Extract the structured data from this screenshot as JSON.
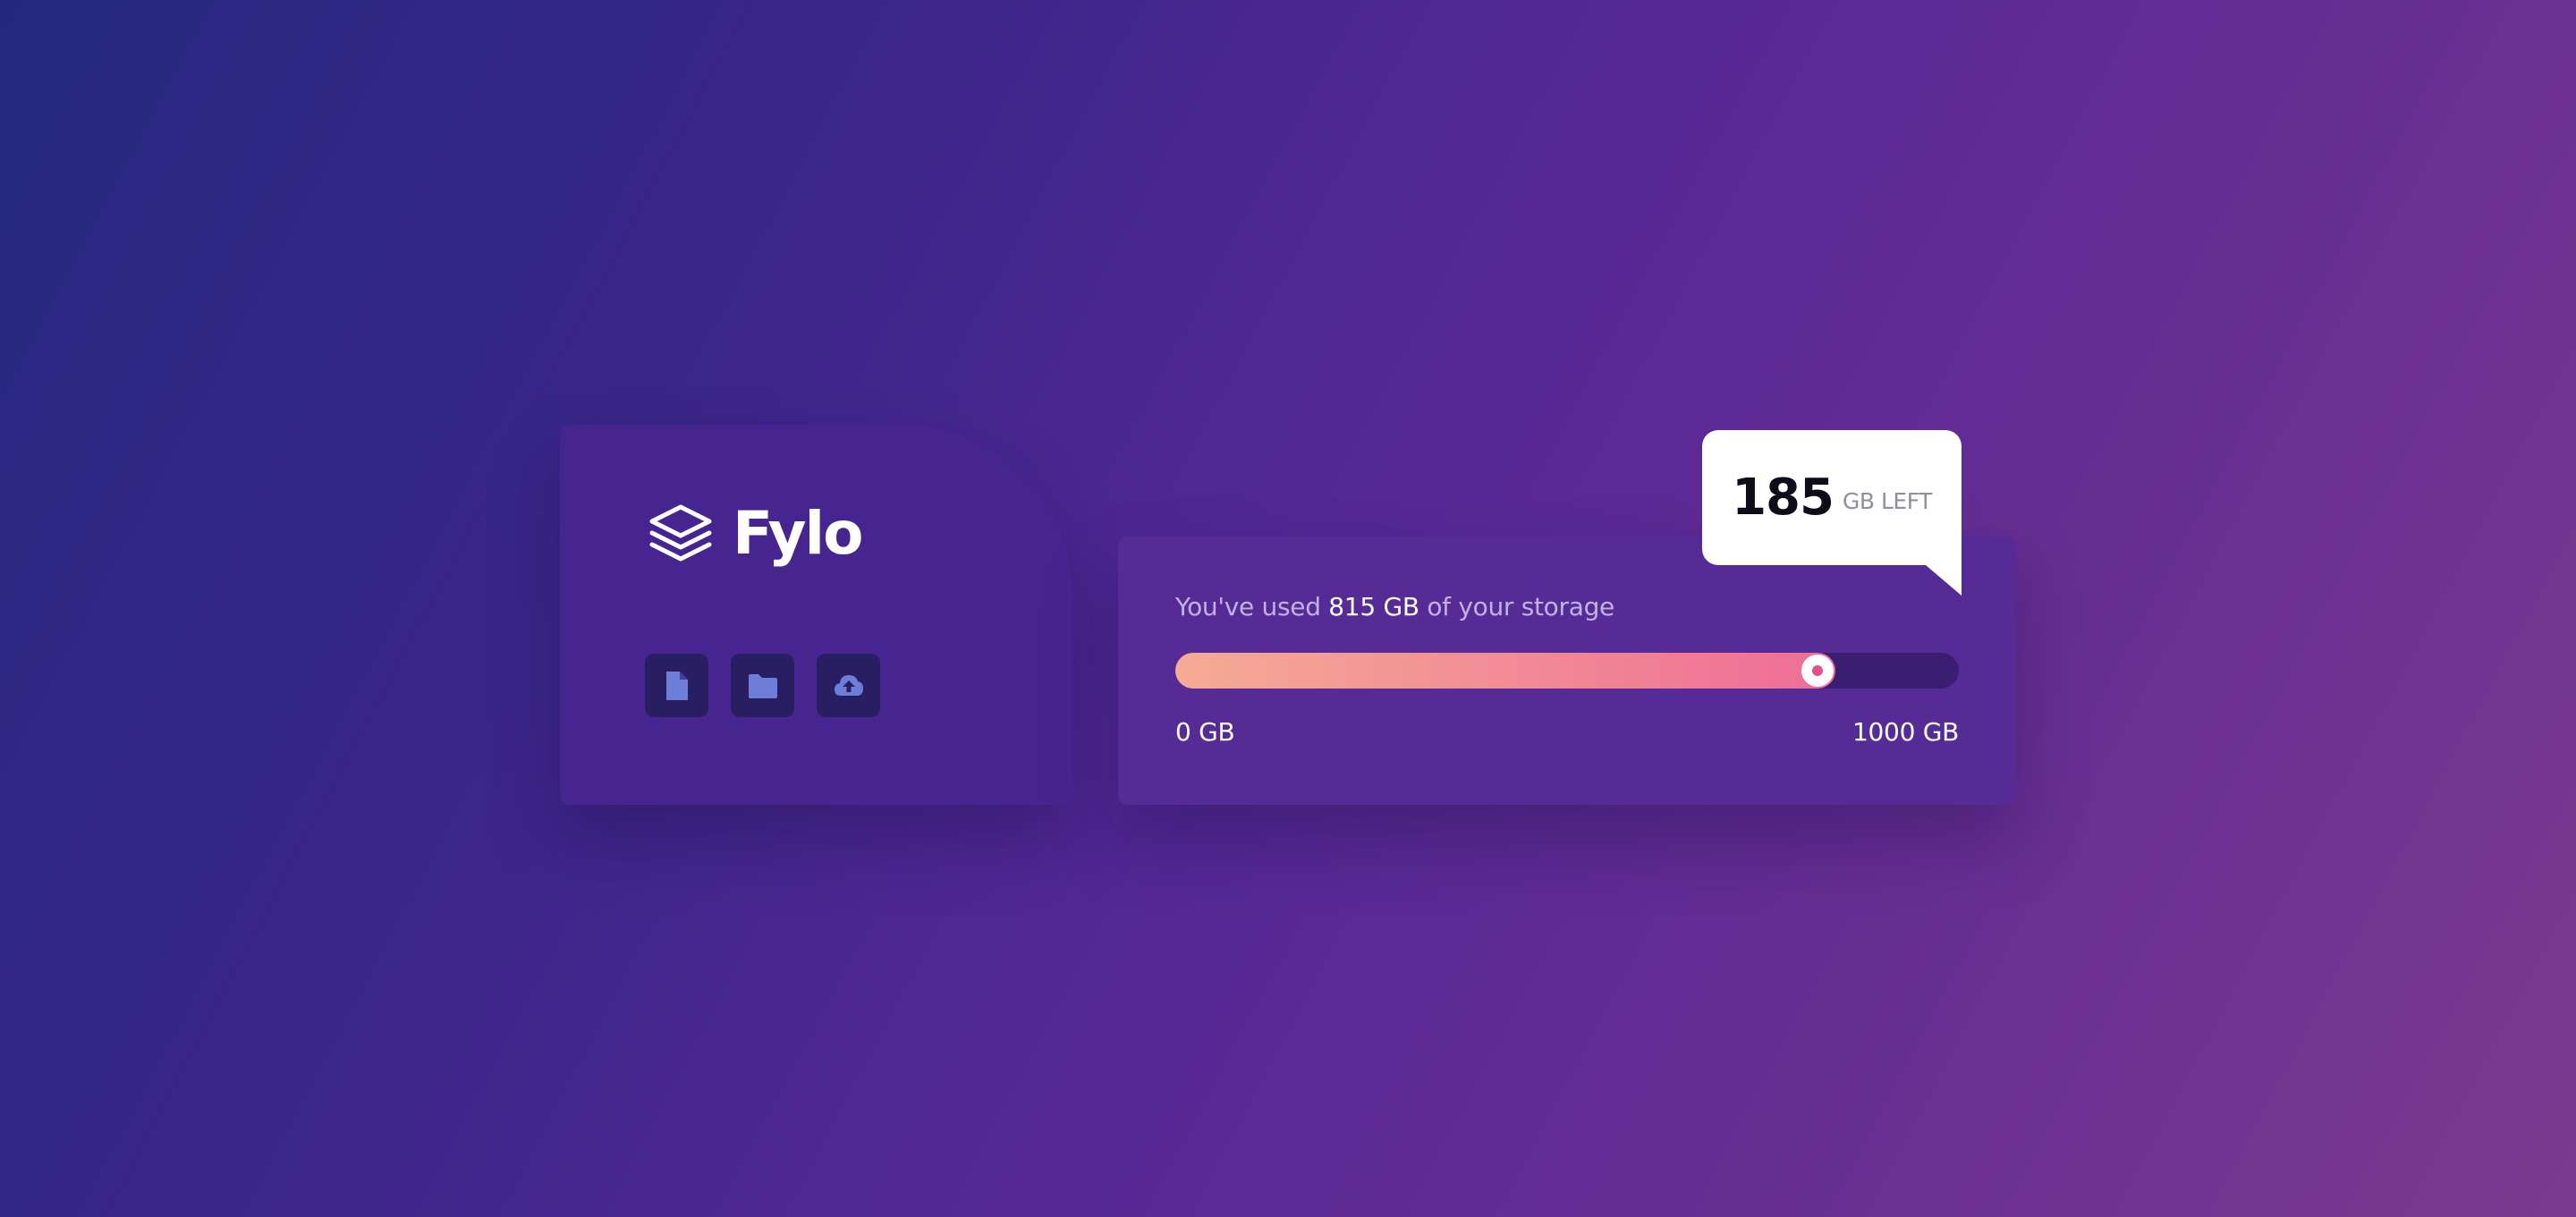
{
  "brand": {
    "name": "Fylo",
    "logo_icon": "stacked-layers-icon"
  },
  "actions": [
    {
      "icon": "document-icon"
    },
    {
      "icon": "folder-icon"
    },
    {
      "icon": "cloud-upload-icon"
    }
  ],
  "storage": {
    "text_before": "You've used ",
    "used_label": "815 GB",
    "text_after": " of your storage",
    "used_gb": 815,
    "total_gb": 1000,
    "min_label": "0 GB",
    "max_label": "1000 GB"
  },
  "callout": {
    "remaining": "185",
    "label": "GB LEFT"
  },
  "colors": {
    "background_start": "#24297f",
    "background_end": "#7a3a8f",
    "brand_card": "#472591",
    "storage_card": "#572b95",
    "icon_tile": "#2a1e63",
    "icon_glyph": "#6d7ed8",
    "bar_gradient_start": "#f5ab95",
    "bar_gradient_end": "#ee6d97",
    "bar_track": "#3a1e72"
  }
}
